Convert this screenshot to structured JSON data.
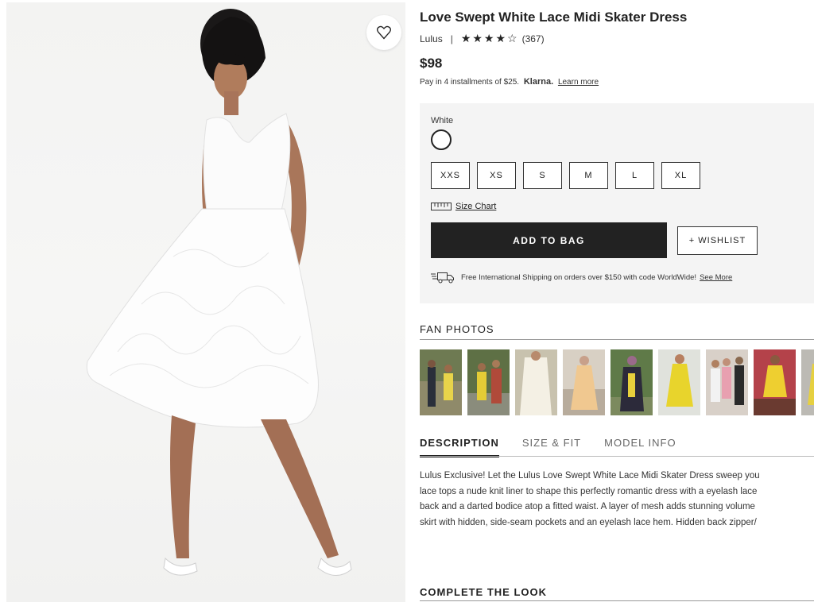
{
  "product": {
    "title": "Love Swept White Lace Midi Skater Dress",
    "brand": "Lulus",
    "stars": "★★★★☆",
    "rating": 4,
    "review_count": "(367)",
    "price": "$98",
    "installment_text": "Pay in 4 installments of $25.",
    "klarna_brand": "Klarna.",
    "learn_more": "Learn more"
  },
  "options": {
    "color_label": "White",
    "sizes": [
      "XXS",
      "XS",
      "S",
      "M",
      "L",
      "XL"
    ],
    "size_chart": "Size Chart",
    "add_to_bag": "ADD TO BAG",
    "wishlist": "+ WISHLIST",
    "shipping_text": "Free International Shipping on orders over $150 with code WorldWide!",
    "see_more": "See More"
  },
  "fan_photos": {
    "title": "FAN PHOTOS",
    "items": [
      "fan-photo-1",
      "fan-photo-2",
      "fan-photo-3",
      "fan-photo-4",
      "fan-photo-5",
      "fan-photo-6",
      "fan-photo-7",
      "fan-photo-8",
      "fan-photo-9"
    ]
  },
  "tabs": [
    {
      "label": "DESCRIPTION",
      "active": true
    },
    {
      "label": "SIZE & FIT",
      "active": false
    },
    {
      "label": "MODEL INFO",
      "active": false
    }
  ],
  "description_lines": [
    "Lulus Exclusive! Let the Lulus Love Swept White Lace Midi Skater Dress sweep you",
    "lace tops a nude knit liner to shape this perfectly romantic dress with a eyelash lace",
    "back and a darted bodice atop a fitted waist. A layer of mesh adds stunning volume",
    "skirt with hidden, side-seam pockets and an eyelash lace hem. Hidden back zipper/"
  ],
  "complete_the_look": "COMPLETE THE LOOK",
  "colors": {
    "button_dark": "#222222",
    "panel_bg": "#f4f4f4",
    "photo_bg": "#f3f3f2"
  },
  "icons": {
    "favorite": "heart-outline-icon",
    "size_chart": "ruler-icon",
    "shipping": "delivery-truck-icon"
  }
}
